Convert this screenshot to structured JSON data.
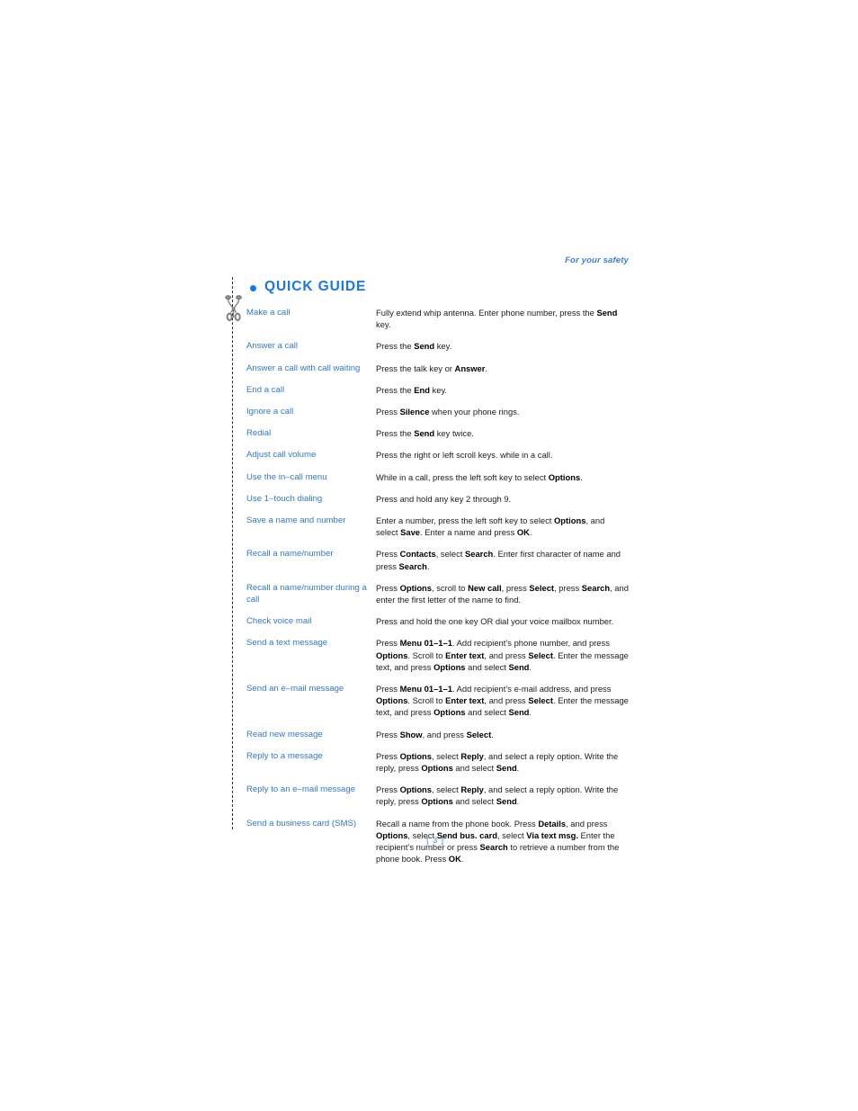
{
  "header": {
    "running_head": "For your safety"
  },
  "section": {
    "bullet_icon": "bullet-dot-icon",
    "title": "QUICK GUIDE"
  },
  "gutter": {
    "scissors_icon": "scissors-icon",
    "cut_line": "dashed-cut-line"
  },
  "quick_guide": [
    {
      "label": "Make a call",
      "action": "Fully extend whip antenna. Enter phone number, press the <b>Send</b> key."
    },
    {
      "label": "Answer a call",
      "action": "Press the <b>Send</b> key."
    },
    {
      "label": "Answer a call with call waiting",
      "action": "Press the talk key or <b>Answer</b>."
    },
    {
      "label": "End a call",
      "action": "Press the <b>End</b> key."
    },
    {
      "label": "Ignore a call",
      "action": "Press <b>Silence</b> when your phone rings."
    },
    {
      "label": "Redial",
      "action": "Press the <b>Send</b> key twice."
    },
    {
      "label": "Adjust call volume",
      "action": "Press the right or left scroll keys. while in a call."
    },
    {
      "label": "Use the in–call menu",
      "action": "While in a call, press the left soft key to select <b>Options</b>."
    },
    {
      "label": "Use 1–touch dialing",
      "action": "Press and hold any key 2 through 9."
    },
    {
      "label": "Save a name and number",
      "action": "Enter a number, press the left soft key to select <b>Options</b>, and select <b>Save</b>. Enter a name and press <b>OK</b>."
    },
    {
      "label": "Recall a name/number",
      "action": "Press <b>Contacts</b>, select <b>Search</b>. Enter first character of name and press <b>Search</b>."
    },
    {
      "label": "Recall a name/number during a call",
      "action": "Press <b>Options</b>, scroll to <b>New call</b>, press <b>Select</b>, press <b>Search</b>, and enter the first letter of the name to find."
    },
    {
      "label": "Check voice mail",
      "action": "Press and hold the one key OR dial your voice mailbox number."
    },
    {
      "label": "Send a text message",
      "action": "Press <b>Menu 01–1–1</b>. Add recipient’s phone number, and press <b>Options</b>. Scroll to <b>Enter text</b>, and press <b>Select</b>. Enter the message text, and press <b>Options</b> and select <b>Send</b>."
    },
    {
      "label": "Send an e–mail message",
      "action": "Press <b>Menu 01–1–1</b>. Add recipient’s e-mail address, and press <b>Options</b>. Scroll to <b>Enter text</b>, and press <b>Select</b>. Enter the message text, and press <b>Options</b> and select <b>Send</b>."
    },
    {
      "label": "Read new message",
      "action": "Press <b>Show</b>, and press <b>Select</b>."
    },
    {
      "label": "Reply to a message",
      "action": "Press <b>Options</b>, select <b>Reply</b>, and select a reply option. Write the reply, press <b>Options</b> and select <b>Send</b>."
    },
    {
      "label": "Reply to an e–mail message",
      "action": "Press <b>Options</b>, select <b>Reply</b>, and select a reply option. Write the reply, press <b>Options</b> and select <b>Send</b>."
    },
    {
      "label": "Send a business card (SMS)",
      "action": "Recall a name from the phone book. Press <b>Details</b>, and press <b>Options</b>, select <b>Send bus. card</b>, select <b>Via text msg.</b> Enter the recipient’s number or press <b>Search</b> to retrieve a number from the phone book. Press <b>OK</b>."
    }
  ],
  "footer": {
    "folio": "[ 3 ]"
  },
  "colors": {
    "heading_blue": "#1877e8",
    "label_blue": "#3178cd",
    "header_blue": "#3b7fdc",
    "folio_blue": "#3b8ae8",
    "body_black": "#1c1c1c"
  }
}
